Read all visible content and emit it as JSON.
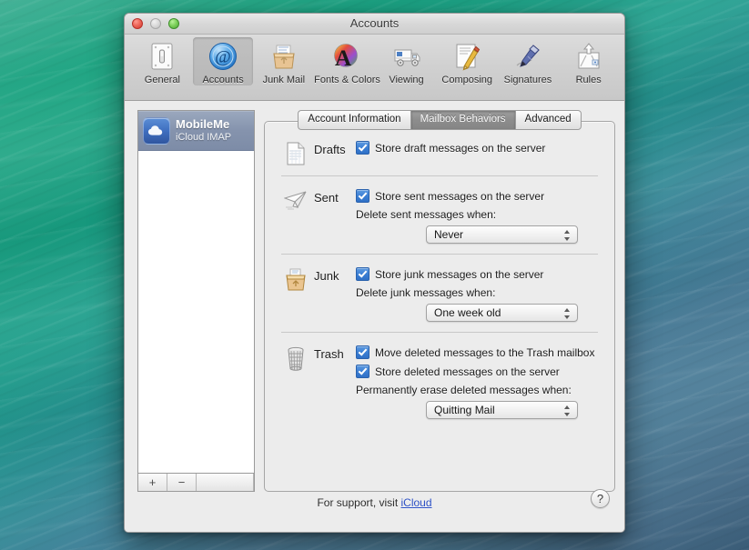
{
  "window": {
    "title": "Accounts",
    "traffic_lights": [
      {
        "name": "close",
        "color": "#cf372c"
      },
      {
        "name": "minimize",
        "color": "#bdbdbd"
      },
      {
        "name": "maximize",
        "color": "#4ea534"
      }
    ]
  },
  "toolbar": {
    "items": [
      {
        "label": "General",
        "icon": "light-switch-icon",
        "selected": false
      },
      {
        "label": "Accounts",
        "icon": "at-sign-icon",
        "selected": true
      },
      {
        "label": "Junk Mail",
        "icon": "paper-bag-icon",
        "selected": false
      },
      {
        "label": "Fonts & Colors",
        "icon": "color-wheel-a-icon",
        "selected": false
      },
      {
        "label": "Viewing",
        "icon": "mail-truck-icon",
        "selected": false
      },
      {
        "label": "Composing",
        "icon": "pencil-notepad-icon",
        "selected": false
      },
      {
        "label": "Signatures",
        "icon": "fountain-pen-icon",
        "selected": false
      },
      {
        "label": "Rules",
        "icon": "mailbox-arrows-icon",
        "selected": false
      }
    ]
  },
  "accounts": {
    "list": [
      {
        "name": "MobileMe",
        "type": "iCloud IMAP",
        "icon": "cloud-icon",
        "selected": true
      }
    ],
    "add_label": "+",
    "remove_label": "−"
  },
  "tabs": [
    {
      "label": "Account Information",
      "active": false
    },
    {
      "label": "Mailbox Behaviors",
      "active": true
    },
    {
      "label": "Advanced",
      "active": false
    }
  ],
  "mailbox_behaviors": {
    "drafts": {
      "title": "Drafts",
      "icon": "draft-page-icon",
      "checkboxes": [
        {
          "label": "Store draft messages on the server",
          "checked": true
        }
      ]
    },
    "sent": {
      "title": "Sent",
      "icon": "paper-plane-icon",
      "checkboxes": [
        {
          "label": "Store sent messages on the server",
          "checked": true
        }
      ],
      "field_label": "Delete sent messages when:",
      "popup_value": "Never"
    },
    "junk": {
      "title": "Junk",
      "icon": "junk-bag-icon",
      "checkboxes": [
        {
          "label": "Store junk messages on the server",
          "checked": true
        }
      ],
      "field_label": "Delete junk messages when:",
      "popup_value": "One week old"
    },
    "trash": {
      "title": "Trash",
      "icon": "trash-can-icon",
      "checkboxes": [
        {
          "label": "Move deleted messages to the Trash mailbox",
          "checked": true
        },
        {
          "label": "Store deleted messages on the server",
          "checked": true
        }
      ],
      "field_label": "Permanently erase deleted messages when:",
      "popup_value": "Quitting Mail"
    }
  },
  "footer": {
    "support_prefix": "For support, visit ",
    "support_link": "iCloud",
    "help_label": "?"
  },
  "colors": {
    "accent_checkbox": "#3b7fd4",
    "link": "#2a4ec4",
    "selection": "#8593ad",
    "window_bg": "#ececec"
  }
}
